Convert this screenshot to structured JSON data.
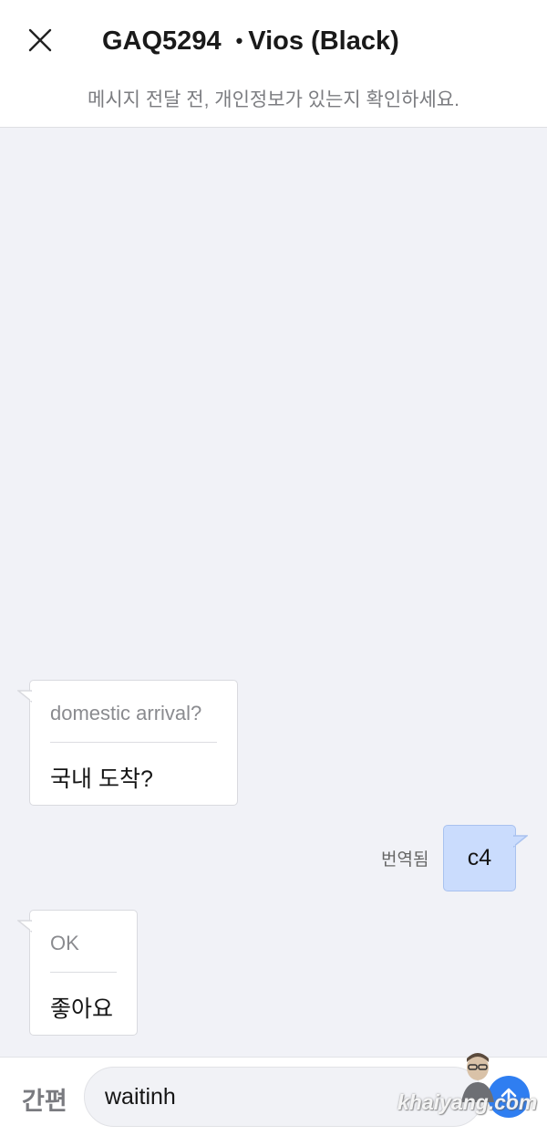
{
  "header": {
    "plate": "GAQ5294",
    "separator": "•",
    "vehicle": "Vios (Black)",
    "notice": "메시지 전달 전, 개인정보가 있는지 확인하세요."
  },
  "messages": [
    {
      "direction": "incoming",
      "original": "domestic arrival?",
      "translated": "국내 도착?"
    },
    {
      "direction": "outgoing",
      "text": "c4",
      "tag": "번역됨"
    },
    {
      "direction": "incoming",
      "original": "OK",
      "translated": "좋아요"
    }
  ],
  "input_bar": {
    "quick_label": "간편",
    "value": "waitinh",
    "send_icon": "arrow-up-icon"
  },
  "watermark": "khaiyang.com",
  "colors": {
    "background": "#f1f2f7",
    "outgoing_bubble": "#cadcfd",
    "send_button": "#2f7ef1"
  }
}
